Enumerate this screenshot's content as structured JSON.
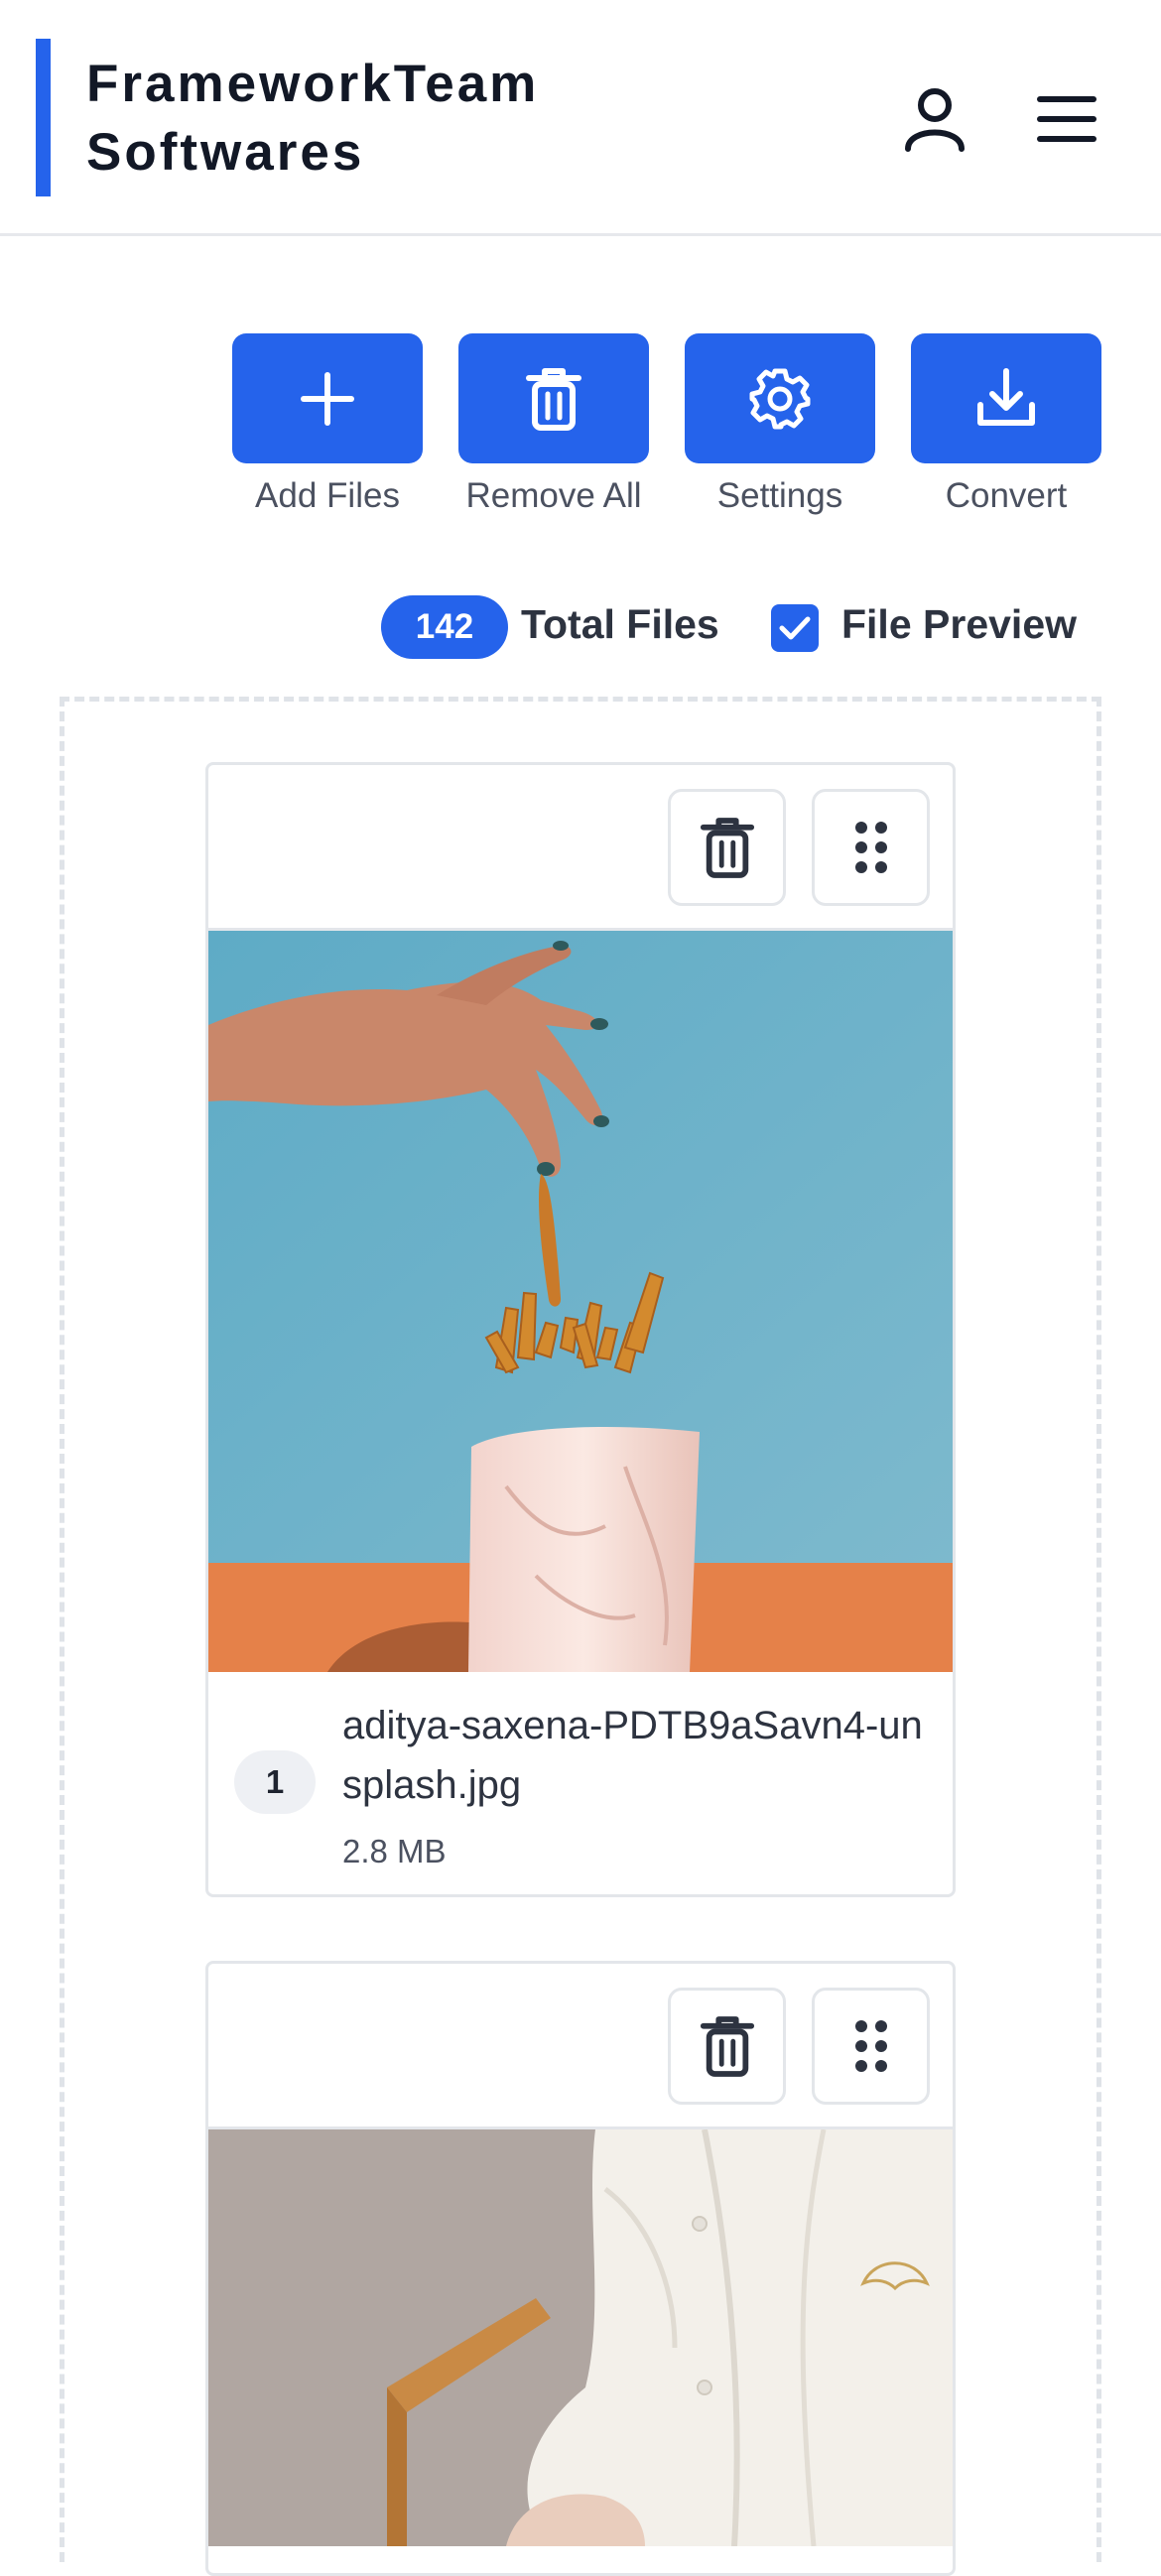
{
  "header": {
    "brand_line1": "FrameworkTeam",
    "brand_line2": "Softwares",
    "accent_color": "#2563eb",
    "icons": [
      "user-icon",
      "hamburger-menu-icon"
    ]
  },
  "toolbar": {
    "add_label": "Add Files",
    "remove_label": "Remove All",
    "settings_label": "Settings",
    "convert_label": "Convert",
    "icons": [
      "plus-icon",
      "trash-icon",
      "gear-icon",
      "download-icon"
    ]
  },
  "stats": {
    "total_count": "142",
    "total_label": "Total Files",
    "preview_label": "File Preview",
    "preview_checked": true
  },
  "files": [
    {
      "index": "1",
      "name": "aditya-saxena-PDTB9aSavn4-unsplash.jpg",
      "size": "2.8 MB",
      "preview": "hand dropping a fry into a white cup of fries on blue background"
    },
    {
      "preview": "person in white shirt seated near wooden chair"
    }
  ]
}
